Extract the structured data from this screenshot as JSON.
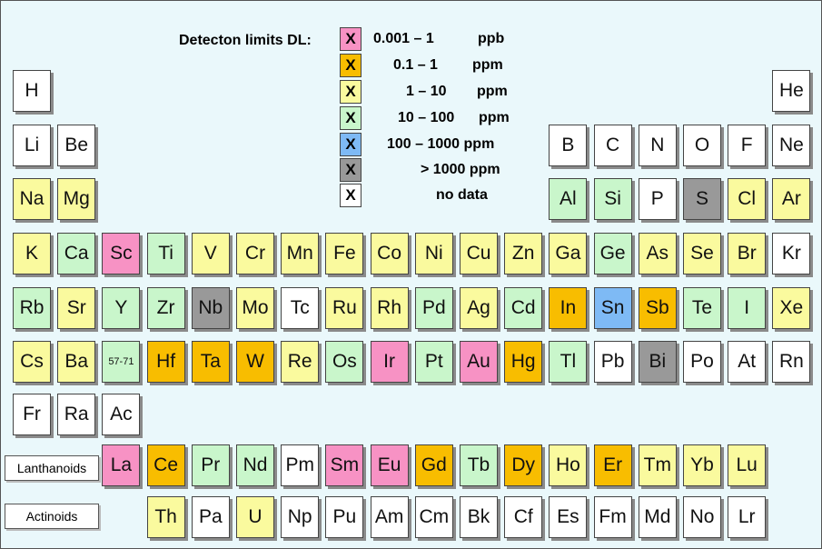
{
  "colors": {
    "ppb": "#f792c4",
    "ppm_0_1": "#f8bd00",
    "ppm_1_10": "#fafa9e",
    "ppm_10_100": "#c9f6cb",
    "ppm_100_1000": "#7ebaf5",
    "gt_1000": "#999999",
    "nodata": "#ffffff"
  },
  "legend": {
    "title": "Detecton limits DL:",
    "items": [
      {
        "mark": "X",
        "range": "0.001 – 1",
        "unit": "ppb",
        "color": "ppb"
      },
      {
        "mark": "X",
        "range": "0.1 – 1",
        "unit": "ppm",
        "color": "ppm_0_1"
      },
      {
        "mark": "X",
        "range": "1 – 10",
        "unit": "ppm",
        "color": "ppm_1_10"
      },
      {
        "mark": "X",
        "range": "10 – 100",
        "unit": "ppm",
        "color": "ppm_10_100"
      },
      {
        "mark": "X",
        "range": "100 – 1000 ppm",
        "unit": "",
        "color": "ppm_100_1000"
      },
      {
        "mark": "X",
        "range": "> 1000 ppm",
        "unit": "",
        "color": "gt_1000"
      },
      {
        "mark": "X",
        "range": "no data",
        "unit": "",
        "color": "nodata"
      }
    ]
  },
  "row_labels": {
    "lanthanoids": "Lanthanoids",
    "actinoids": "Actinoids"
  },
  "elements": [
    {
      "symbol": "H",
      "row": 1,
      "col": 1,
      "color": "nodata"
    },
    {
      "symbol": "He",
      "row": 1,
      "col": 18,
      "color": "nodata"
    },
    {
      "symbol": "Li",
      "row": 2,
      "col": 1,
      "color": "nodata"
    },
    {
      "symbol": "Be",
      "row": 2,
      "col": 2,
      "color": "nodata"
    },
    {
      "symbol": "B",
      "row": 2,
      "col": 13,
      "color": "nodata"
    },
    {
      "symbol": "C",
      "row": 2,
      "col": 14,
      "color": "nodata"
    },
    {
      "symbol": "N",
      "row": 2,
      "col": 15,
      "color": "nodata"
    },
    {
      "symbol": "O",
      "row": 2,
      "col": 16,
      "color": "nodata"
    },
    {
      "symbol": "F",
      "row": 2,
      "col": 17,
      "color": "nodata"
    },
    {
      "symbol": "Ne",
      "row": 2,
      "col": 18,
      "color": "nodata"
    },
    {
      "symbol": "Na",
      "row": 3,
      "col": 1,
      "color": "ppm_1_10"
    },
    {
      "symbol": "Mg",
      "row": 3,
      "col": 2,
      "color": "ppm_1_10"
    },
    {
      "symbol": "Al",
      "row": 3,
      "col": 13,
      "color": "ppm_10_100"
    },
    {
      "symbol": "Si",
      "row": 3,
      "col": 14,
      "color": "ppm_10_100"
    },
    {
      "symbol": "P",
      "row": 3,
      "col": 15,
      "color": "nodata"
    },
    {
      "symbol": "S",
      "row": 3,
      "col": 16,
      "color": "gt_1000"
    },
    {
      "symbol": "Cl",
      "row": 3,
      "col": 17,
      "color": "ppm_1_10"
    },
    {
      "symbol": "Ar",
      "row": 3,
      "col": 18,
      "color": "ppm_1_10"
    },
    {
      "symbol": "K",
      "row": 4,
      "col": 1,
      "color": "ppm_1_10"
    },
    {
      "symbol": "Ca",
      "row": 4,
      "col": 2,
      "color": "ppm_10_100"
    },
    {
      "symbol": "Sc",
      "row": 4,
      "col": 3,
      "color": "ppb"
    },
    {
      "symbol": "Ti",
      "row": 4,
      "col": 4,
      "color": "ppm_10_100"
    },
    {
      "symbol": "V",
      "row": 4,
      "col": 5,
      "color": "ppm_1_10"
    },
    {
      "symbol": "Cr",
      "row": 4,
      "col": 6,
      "color": "ppm_1_10"
    },
    {
      "symbol": "Mn",
      "row": 4,
      "col": 7,
      "color": "ppm_1_10"
    },
    {
      "symbol": "Fe",
      "row": 4,
      "col": 8,
      "color": "ppm_1_10"
    },
    {
      "symbol": "Co",
      "row": 4,
      "col": 9,
      "color": "ppm_1_10"
    },
    {
      "symbol": "Ni",
      "row": 4,
      "col": 10,
      "color": "ppm_1_10"
    },
    {
      "symbol": "Cu",
      "row": 4,
      "col": 11,
      "color": "ppm_1_10"
    },
    {
      "symbol": "Zn",
      "row": 4,
      "col": 12,
      "color": "ppm_1_10"
    },
    {
      "symbol": "Ga",
      "row": 4,
      "col": 13,
      "color": "ppm_1_10"
    },
    {
      "symbol": "Ge",
      "row": 4,
      "col": 14,
      "color": "ppm_10_100"
    },
    {
      "symbol": "As",
      "row": 4,
      "col": 15,
      "color": "ppm_1_10"
    },
    {
      "symbol": "Se",
      "row": 4,
      "col": 16,
      "color": "ppm_1_10"
    },
    {
      "symbol": "Br",
      "row": 4,
      "col": 17,
      "color": "ppm_1_10"
    },
    {
      "symbol": "Kr",
      "row": 4,
      "col": 18,
      "color": "nodata"
    },
    {
      "symbol": "Rb",
      "row": 5,
      "col": 1,
      "color": "ppm_10_100"
    },
    {
      "symbol": "Sr",
      "row": 5,
      "col": 2,
      "color": "ppm_1_10"
    },
    {
      "symbol": "Y",
      "row": 5,
      "col": 3,
      "color": "ppm_10_100"
    },
    {
      "symbol": "Zr",
      "row": 5,
      "col": 4,
      "color": "ppm_10_100"
    },
    {
      "symbol": "Nb",
      "row": 5,
      "col": 5,
      "color": "gt_1000"
    },
    {
      "symbol": "Mo",
      "row": 5,
      "col": 6,
      "color": "ppm_1_10"
    },
    {
      "symbol": "Tc",
      "row": 5,
      "col": 7,
      "color": "nodata"
    },
    {
      "symbol": "Ru",
      "row": 5,
      "col": 8,
      "color": "ppm_1_10"
    },
    {
      "symbol": "Rh",
      "row": 5,
      "col": 9,
      "color": "ppm_1_10"
    },
    {
      "symbol": "Pd",
      "row": 5,
      "col": 10,
      "color": "ppm_10_100"
    },
    {
      "symbol": "Ag",
      "row": 5,
      "col": 11,
      "color": "ppm_1_10"
    },
    {
      "symbol": "Cd",
      "row": 5,
      "col": 12,
      "color": "ppm_10_100"
    },
    {
      "symbol": "In",
      "row": 5,
      "col": 13,
      "color": "ppm_0_1"
    },
    {
      "symbol": "Sn",
      "row": 5,
      "col": 14,
      "color": "ppm_100_1000"
    },
    {
      "symbol": "Sb",
      "row": 5,
      "col": 15,
      "color": "ppm_0_1"
    },
    {
      "symbol": "Te",
      "row": 5,
      "col": 16,
      "color": "ppm_10_100"
    },
    {
      "symbol": "I",
      "row": 5,
      "col": 17,
      "color": "ppm_10_100"
    },
    {
      "symbol": "Xe",
      "row": 5,
      "col": 18,
      "color": "ppm_1_10"
    },
    {
      "symbol": "Cs",
      "row": 6,
      "col": 1,
      "color": "ppm_1_10"
    },
    {
      "symbol": "Ba",
      "row": 6,
      "col": 2,
      "color": "ppm_1_10"
    },
    {
      "symbol": "57-71",
      "row": 6,
      "col": 3,
      "color": "ppm_10_100",
      "small": true
    },
    {
      "symbol": "Hf",
      "row": 6,
      "col": 4,
      "color": "ppm_0_1"
    },
    {
      "symbol": "Ta",
      "row": 6,
      "col": 5,
      "color": "ppm_0_1"
    },
    {
      "symbol": "W",
      "row": 6,
      "col": 6,
      "color": "ppm_0_1"
    },
    {
      "symbol": "Re",
      "row": 6,
      "col": 7,
      "color": "ppm_1_10"
    },
    {
      "symbol": "Os",
      "row": 6,
      "col": 8,
      "color": "ppm_10_100"
    },
    {
      "symbol": "Ir",
      "row": 6,
      "col": 9,
      "color": "ppb"
    },
    {
      "symbol": "Pt",
      "row": 6,
      "col": 10,
      "color": "ppm_10_100"
    },
    {
      "symbol": "Au",
      "row": 6,
      "col": 11,
      "color": "ppb"
    },
    {
      "symbol": "Hg",
      "row": 6,
      "col": 12,
      "color": "ppm_0_1"
    },
    {
      "symbol": "Tl",
      "row": 6,
      "col": 13,
      "color": "ppm_10_100"
    },
    {
      "symbol": "Pb",
      "row": 6,
      "col": 14,
      "color": "nodata"
    },
    {
      "symbol": "Bi",
      "row": 6,
      "col": 15,
      "color": "gt_1000"
    },
    {
      "symbol": "Po",
      "row": 6,
      "col": 16,
      "color": "nodata"
    },
    {
      "symbol": "At",
      "row": 6,
      "col": 17,
      "color": "nodata"
    },
    {
      "symbol": "Rn",
      "row": 6,
      "col": 18,
      "color": "nodata"
    },
    {
      "symbol": "Fr",
      "row": 7,
      "col": 1,
      "color": "nodata"
    },
    {
      "symbol": "Ra",
      "row": 7,
      "col": 2,
      "color": "nodata"
    },
    {
      "symbol": "Ac",
      "row": 7,
      "col": 3,
      "color": "nodata"
    },
    {
      "symbol": "La",
      "row": 8,
      "col": 3,
      "color": "ppb"
    },
    {
      "symbol": "Ce",
      "row": 8,
      "col": 4,
      "color": "ppm_0_1"
    },
    {
      "symbol": "Pr",
      "row": 8,
      "col": 5,
      "color": "ppm_10_100"
    },
    {
      "symbol": "Nd",
      "row": 8,
      "col": 6,
      "color": "ppm_10_100"
    },
    {
      "symbol": "Pm",
      "row": 8,
      "col": 7,
      "color": "nodata"
    },
    {
      "symbol": "Sm",
      "row": 8,
      "col": 8,
      "color": "ppb"
    },
    {
      "symbol": "Eu",
      "row": 8,
      "col": 9,
      "color": "ppb"
    },
    {
      "symbol": "Gd",
      "row": 8,
      "col": 10,
      "color": "ppm_0_1"
    },
    {
      "symbol": "Tb",
      "row": 8,
      "col": 11,
      "color": "ppm_10_100"
    },
    {
      "symbol": "Dy",
      "row": 8,
      "col": 12,
      "color": "ppm_0_1"
    },
    {
      "symbol": "Ho",
      "row": 8,
      "col": 13,
      "color": "ppm_1_10"
    },
    {
      "symbol": "Er",
      "row": 8,
      "col": 14,
      "color": "ppm_0_1"
    },
    {
      "symbol": "Tm",
      "row": 8,
      "col": 15,
      "color": "ppm_1_10"
    },
    {
      "symbol": "Yb",
      "row": 8,
      "col": 16,
      "color": "ppm_1_10"
    },
    {
      "symbol": "Lu",
      "row": 8,
      "col": 17,
      "color": "ppm_1_10"
    },
    {
      "symbol": "Th",
      "row": 9,
      "col": 4,
      "color": "ppm_1_10"
    },
    {
      "symbol": "Pa",
      "row": 9,
      "col": 5,
      "color": "nodata"
    },
    {
      "symbol": "U",
      "row": 9,
      "col": 6,
      "color": "ppm_1_10"
    },
    {
      "symbol": "Np",
      "row": 9,
      "col": 7,
      "color": "nodata"
    },
    {
      "symbol": "Pu",
      "row": 9,
      "col": 8,
      "color": "nodata"
    },
    {
      "symbol": "Am",
      "row": 9,
      "col": 9,
      "color": "nodata"
    },
    {
      "symbol": "Cm",
      "row": 9,
      "col": 10,
      "color": "nodata"
    },
    {
      "symbol": "Bk",
      "row": 9,
      "col": 11,
      "color": "nodata"
    },
    {
      "symbol": "Cf",
      "row": 9,
      "col": 12,
      "color": "nodata"
    },
    {
      "symbol": "Es",
      "row": 9,
      "col": 13,
      "color": "nodata"
    },
    {
      "symbol": "Fm",
      "row": 9,
      "col": 14,
      "color": "nodata"
    },
    {
      "symbol": "Md",
      "row": 9,
      "col": 15,
      "color": "nodata"
    },
    {
      "symbol": "No",
      "row": 9,
      "col": 16,
      "color": "nodata"
    },
    {
      "symbol": "Lr",
      "row": 9,
      "col": 17,
      "color": "nodata"
    }
  ]
}
